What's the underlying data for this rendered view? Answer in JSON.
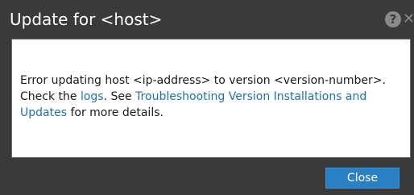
{
  "dialog": {
    "title": "Update for <host>",
    "icons": {
      "help": "help-icon",
      "close": "close-icon",
      "help_glyph": "?",
      "close_glyph": "✕"
    },
    "message": {
      "part1": "Error updating host <ip-address> to version <version-number>. Check the ",
      "logs_link": "logs",
      "part2": ".  See ",
      "troubleshooting_link": "Troubleshooting Version Installations and Updates",
      "part3": " for more details."
    },
    "close_button_label": "Close"
  },
  "colors": {
    "title_bar": "#3a3a3a",
    "content_bg": "#ffffff",
    "link": "#1f6fb8",
    "button": "#2a80c4"
  }
}
